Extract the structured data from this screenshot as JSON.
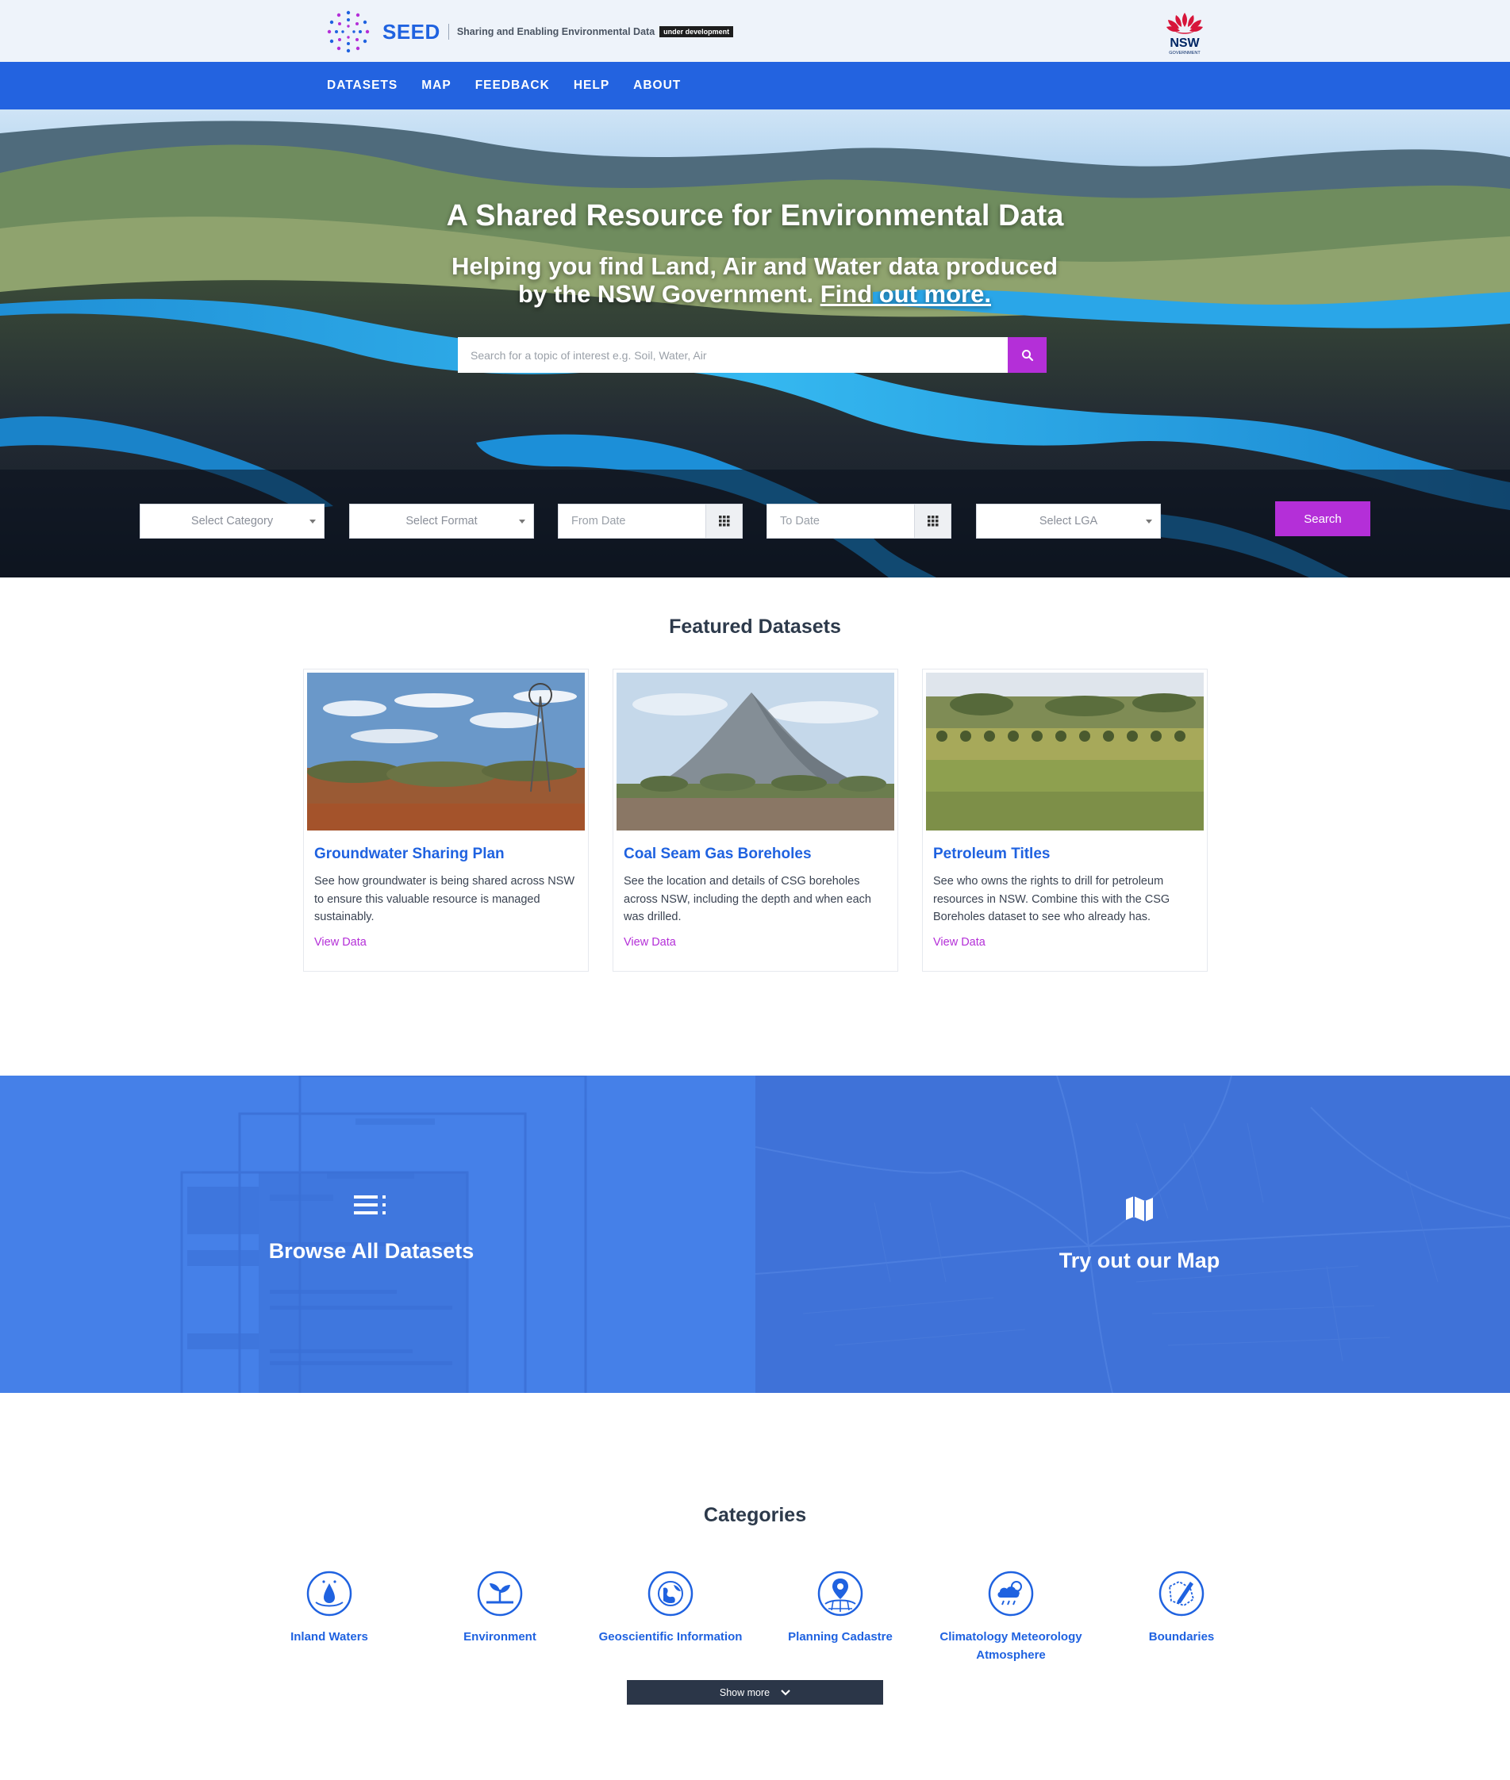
{
  "header": {
    "brand_name": "SEED",
    "brand_tagline": "Sharing and Enabling Environmental Data",
    "brand_badge": "under development",
    "gov_logo_text": "NSW",
    "gov_logo_sub": "GOVERNMENT"
  },
  "nav": {
    "items": [
      {
        "label": "DATASETS"
      },
      {
        "label": "MAP"
      },
      {
        "label": "FEEDBACK"
      },
      {
        "label": "HELP"
      },
      {
        "label": "ABOUT"
      }
    ]
  },
  "hero": {
    "title": "A Shared Resource for Environmental Data",
    "subtitle_line1": "Helping you find Land, Air and Water data produced",
    "subtitle_line2": "by the NSW Government.",
    "subtitle_link": "Find out more.",
    "search_placeholder": "Search for a topic of interest e.g. Soil, Water, Air"
  },
  "filters": {
    "category": "Select Category",
    "format": "Select Format",
    "from_date_placeholder": "From Date",
    "to_date_placeholder": "To Date",
    "lga": "Select LGA",
    "search_label": "Search"
  },
  "featured": {
    "title": "Featured Datasets",
    "cards": [
      {
        "title": "Groundwater Sharing Plan",
        "desc": "See how groundwater is being shared across NSW to ensure this valuable resource is managed sustainably.",
        "link": "View Data"
      },
      {
        "title": "Coal Seam Gas Boreholes",
        "desc": "See the location and details of CSG boreholes across NSW, including the depth and when each was drilled.",
        "link": "View Data"
      },
      {
        "title": "Petroleum Titles",
        "desc": "See who owns the rights to drill for petroleum resources in NSW. Combine this with the CSG Boreholes dataset to see who already has.",
        "link": "View Data"
      }
    ]
  },
  "promo": {
    "browse_label": "Browse All Datasets",
    "map_label": "Try out our Map"
  },
  "categories": {
    "title": "Categories",
    "items": [
      {
        "label": "Inland Waters",
        "icon": "water-drop-icon"
      },
      {
        "label": "Environment",
        "icon": "seedling-icon"
      },
      {
        "label": "Geoscientific Information",
        "icon": "globe-icon"
      },
      {
        "label": "Planning Cadastre",
        "icon": "map-pin-icon"
      },
      {
        "label": "Climatology Meteorology Atmosphere",
        "icon": "cloud-rain-icon"
      },
      {
        "label": "Boundaries",
        "icon": "boundary-pen-icon"
      }
    ],
    "show_more": "Show more"
  },
  "colors": {
    "primary": "#2363e0",
    "accent": "#b42fd8",
    "dark": "#2b3648"
  }
}
